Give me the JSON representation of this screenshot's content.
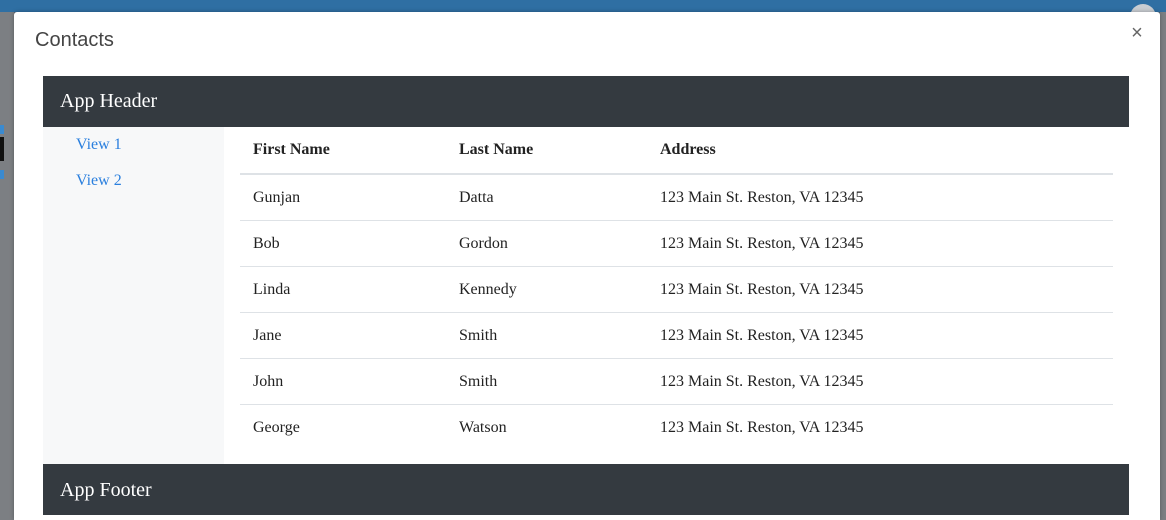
{
  "dialog": {
    "title": "Contacts",
    "close_glyph": "×"
  },
  "app": {
    "header": "App Header",
    "footer": "App Footer",
    "nav": [
      {
        "label": "View 1"
      },
      {
        "label": "View 2"
      }
    ]
  },
  "table": {
    "headers": {
      "first": "First Name",
      "last": "Last Name",
      "address": "Address"
    },
    "rows": [
      {
        "first": "Gunjan",
        "last": "Datta",
        "address": "123 Main St. Reston, VA 12345"
      },
      {
        "first": "Bob",
        "last": "Gordon",
        "address": "123 Main St. Reston, VA 12345"
      },
      {
        "first": "Linda",
        "last": "Kennedy",
        "address": "123 Main St. Reston, VA 12345"
      },
      {
        "first": "Jane",
        "last": "Smith",
        "address": "123 Main St. Reston, VA 12345"
      },
      {
        "first": "John",
        "last": "Smith",
        "address": "123 Main St. Reston, VA 12345"
      },
      {
        "first": "George",
        "last": "Watson",
        "address": "123 Main St. Reston, VA 12345"
      }
    ]
  },
  "colors": {
    "header_bg": "#343a40",
    "link": "#2a7fde",
    "sidebar_bg": "#f7f8f9"
  }
}
